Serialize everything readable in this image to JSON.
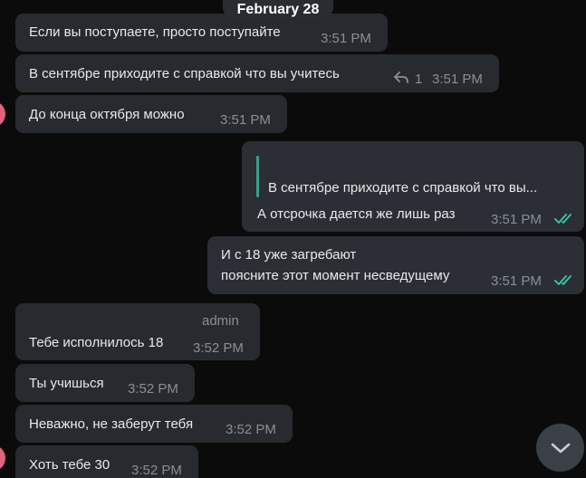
{
  "chat": {
    "date_separator": "February 28",
    "messages": [
      {
        "text": "Если вы поступаете, просто поступайте",
        "time": "3:51 PM"
      },
      {
        "text": "В сентябре приходите с справкой что вы учитесь",
        "replies": "1",
        "time": "3:51 PM"
      },
      {
        "text": "До конца октября можно",
        "time": "3:51 PM"
      },
      {
        "quote": "В сентябре приходите с справкой что вы...",
        "text": "А отсрочка дается же лишь раз",
        "time": "3:51 PM"
      },
      {
        "line1": "И с 18 уже загребают",
        "line2": "поясните этот момент несведущему",
        "time": "3:51 PM"
      },
      {
        "author": "admin",
        "text": "Тебе исполнилось 18",
        "time": "3:52 PM"
      },
      {
        "text": "Ты учишься",
        "time": "3:52 PM"
      },
      {
        "text": "Неважно, не заберут тебя",
        "time": "3:52 PM"
      },
      {
        "text": "Хоть тебе 30",
        "time": "3:52 PM"
      }
    ]
  },
  "colors": {
    "background": "#0b0b0b",
    "incoming_bubble": "#272a2f",
    "outgoing_bubble": "#2b2f35",
    "read_check": "#3ec6a8",
    "reply_bar": "#3e9e8e",
    "avatar": "#e0627c"
  },
  "icons": {
    "reply": "reply-arrow-icon",
    "read_status": "double-check-icon",
    "scroll_down": "chevron-down-icon"
  }
}
